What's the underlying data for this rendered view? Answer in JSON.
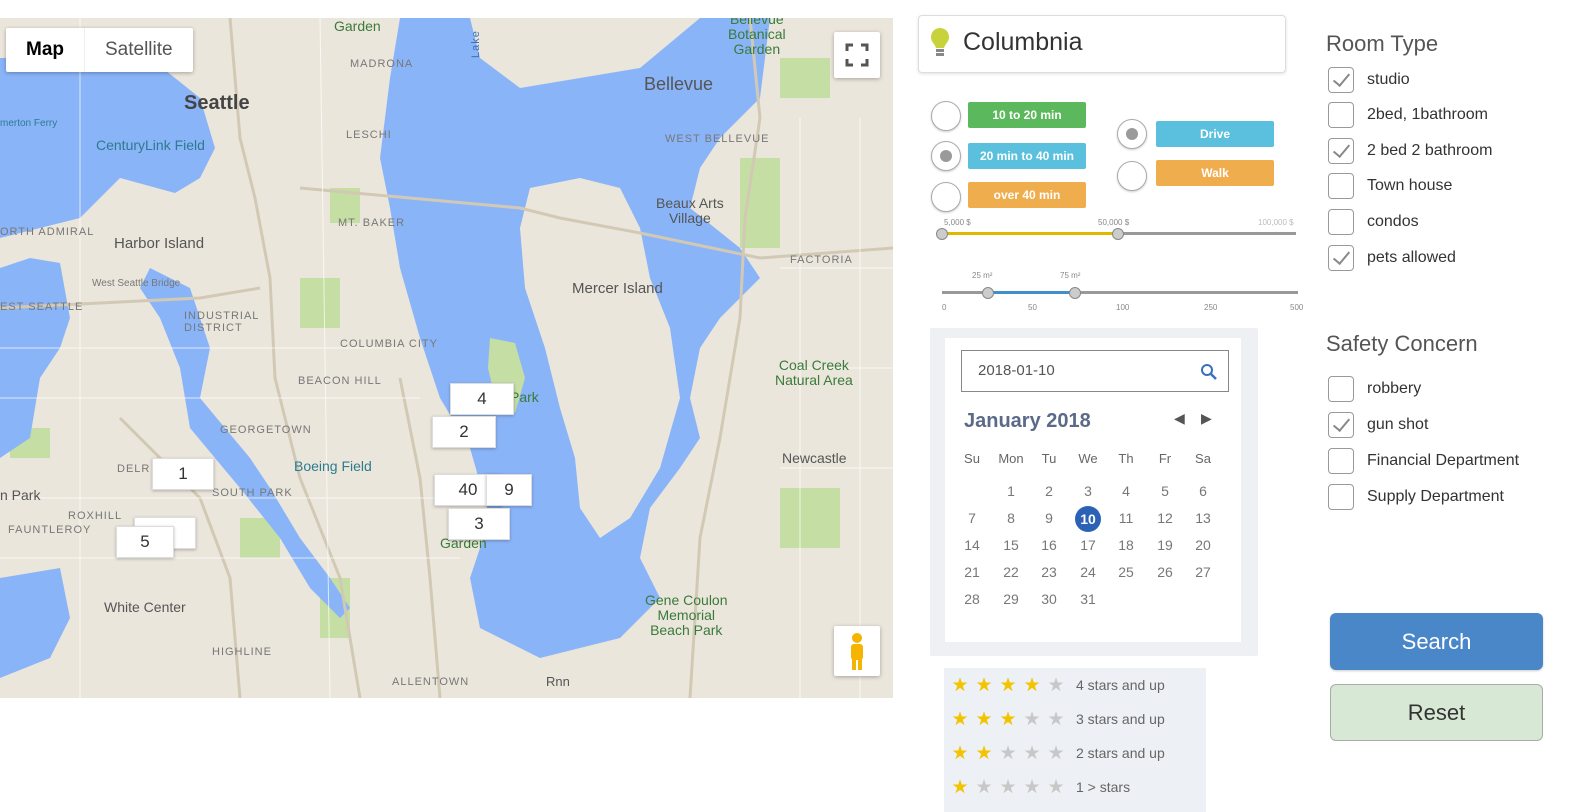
{
  "map": {
    "toggle": {
      "map_label": "Map",
      "satellite_label": "Satellite"
    },
    "labels": {
      "seattle": "Seattle",
      "bellevue": "Bellevue",
      "bellevue_garden": "Bellevue\nBotanical\nGarden",
      "garden_top": "Garden",
      "madrona": "MADRONA",
      "centurylink": "CenturyLink Field",
      "leschi": "LESCHI",
      "west_bellevue": "WEST BELLEVUE",
      "mt_baker": "MT. BAKER",
      "harbor_island": "Harbor Island",
      "beaux_arts": "Beaux Arts\nVillage",
      "factoria": "FACTORIA",
      "mercer_island": "Mercer Island",
      "west_seattle_bridge": "West Seattle Bridge",
      "industrial": "INDUSTRIAL\nDISTRICT",
      "columbia_city": "COLUMBIA CITY",
      "beacon_hill": "BEACON HILL",
      "coal_creek": "Coal Creek\nNatural Area",
      "park_partial": "Park",
      "georgetown": "GEORGETOWN",
      "delr": "DELR",
      "boeing_field": "Boeing Field",
      "south_park": "SOUTH PARK",
      "newcastle": "Newcastle",
      "in_park": "n Park",
      "roxhill": "ROXHILL",
      "fauntleroy": "FAUNTLEROY",
      "garden_bottom": "Garden",
      "white_center": "White Center",
      "gene_coulon": "Gene Coulon\nMemorial\nBeach Park",
      "highline": "HIGHLINE",
      "allentown": "ALLENTOWN",
      "rnn": "Rnn",
      "orth_admiral": "ORTH ADMIRAL",
      "est_seattle": "EST SEATTLE",
      "merton_ferry": "merton Ferry",
      "lake": "Lake"
    },
    "markers": [
      "4",
      "2",
      "1",
      "40",
      "9",
      "3",
      "5",
      "1"
    ]
  },
  "location": {
    "value": "Columbnia"
  },
  "travel": {
    "options": [
      {
        "label": "10 to 20 min",
        "color": "#5cb85c",
        "selected": false
      },
      {
        "label": "20 min to 40 min",
        "color": "#5bc0de",
        "selected": true
      },
      {
        "label": "over 40 min",
        "color": "#f0ad4e",
        "selected": false
      }
    ],
    "modes": [
      {
        "label": "Drive",
        "color": "#5bc0de",
        "selected": true
      },
      {
        "label": "Walk",
        "color": "#f0ad4e",
        "selected": false
      }
    ]
  },
  "price_slider": {
    "min_label": "5,000 $",
    "max_label": "50,000 $",
    "end_label": "100,000 $",
    "low": 5000,
    "high": 50000
  },
  "area_slider": {
    "low_label": "25 m²",
    "high_label": "75 m²",
    "ticks": [
      "0",
      "50",
      "100",
      "250",
      "500"
    ],
    "low": 25,
    "high": 75
  },
  "calendar": {
    "input_value": "2018-01-10",
    "month_title": "January 2018",
    "weekdays": [
      "Su",
      "Mon",
      "Tu",
      "We",
      "Th",
      "Fr",
      "Sa"
    ],
    "weeks": [
      [
        "",
        "1",
        "2",
        "3",
        "4",
        "5",
        "6"
      ],
      [
        "7",
        "8",
        "9",
        "10",
        "11",
        "12",
        "13"
      ],
      [
        "14",
        "15",
        "16",
        "17",
        "18",
        "19",
        "20"
      ],
      [
        "21",
        "22",
        "23",
        "24",
        "25",
        "26",
        "27"
      ],
      [
        "28",
        "29",
        "30",
        "31",
        "",
        "",
        ""
      ]
    ],
    "selected_day": "10"
  },
  "stars": [
    {
      "label": "4 stars and up",
      "rating": 4
    },
    {
      "label": "3 stars and up",
      "rating": 3
    },
    {
      "label": "2 stars and up",
      "rating": 2
    },
    {
      "label": "1 > stars",
      "rating": 1
    }
  ],
  "room_type": {
    "title": "Room Type",
    "items": [
      {
        "label": "studio",
        "checked": true
      },
      {
        "label": "2bed, 1bathroom",
        "checked": false
      },
      {
        "label": "2 bed 2 bathroom",
        "checked": true
      },
      {
        "label": "Town house",
        "checked": false
      },
      {
        "label": "condos",
        "checked": false
      },
      {
        "label": "pets allowed",
        "checked": true
      }
    ]
  },
  "safety": {
    "title": "Safety Concern",
    "items": [
      {
        "label": "robbery",
        "checked": false
      },
      {
        "label": "gun shot",
        "checked": true
      },
      {
        "label": "Financial Department",
        "checked": false
      },
      {
        "label": "Supply Department",
        "checked": false
      }
    ]
  },
  "actions": {
    "search_label": "Search",
    "reset_label": "Reset"
  },
  "colors": {
    "water": "#8ab4f8",
    "land": "#ebe6dc",
    "park": "#c5dea4",
    "search": "#4a87c8",
    "reset": "#d7e8d4"
  }
}
